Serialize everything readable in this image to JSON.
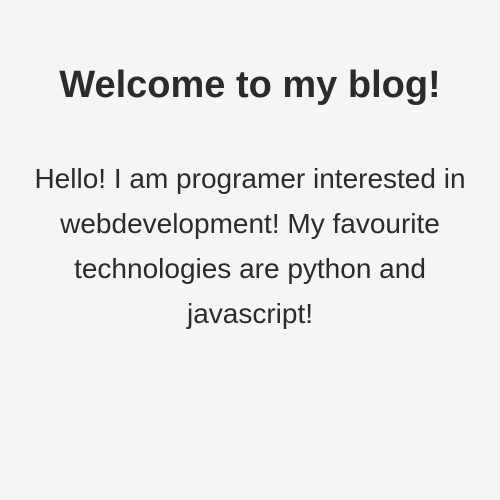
{
  "page": {
    "title": "Welcome to my blog!",
    "intro": "Hello! I am programer interested in webdevelopment! My favourite technologies are python and javascript!"
  },
  "colors": {
    "background": "#f5f5f5",
    "text": "#2b2b2b"
  }
}
